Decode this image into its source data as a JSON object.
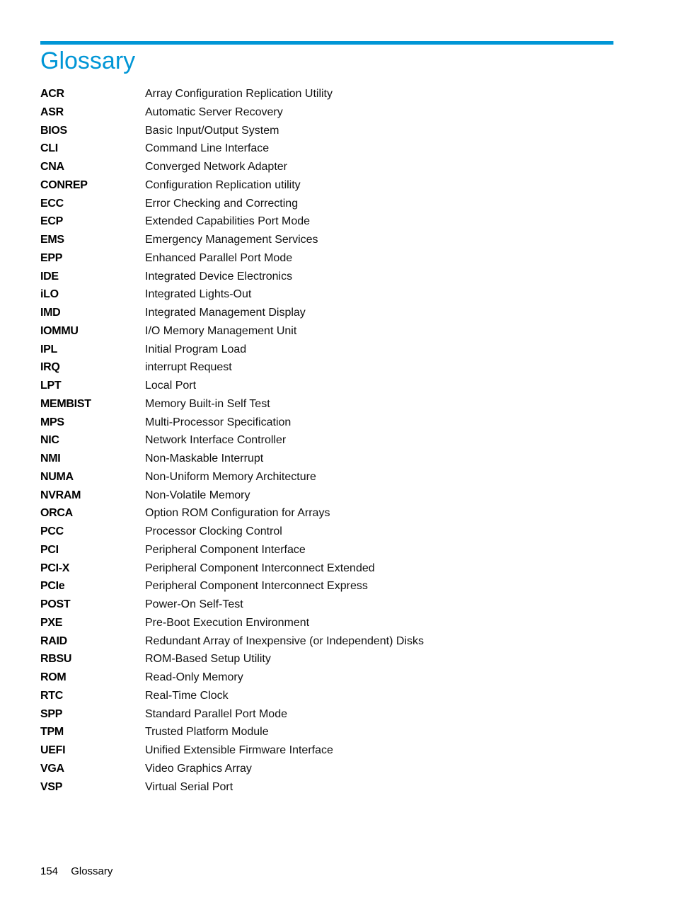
{
  "page": {
    "title": "Glossary",
    "accent_color": "#0096d6"
  },
  "glossary": [
    {
      "term": "ACR",
      "definition": "Array Configuration Replication Utility"
    },
    {
      "term": "ASR",
      "definition": "Automatic Server Recovery"
    },
    {
      "term": "BIOS",
      "definition": "Basic Input/Output System"
    },
    {
      "term": "CLI",
      "definition": "Command Line Interface"
    },
    {
      "term": "CNA",
      "definition": "Converged Network Adapter"
    },
    {
      "term": "CONREP",
      "definition": "Configuration Replication utility"
    },
    {
      "term": "ECC",
      "definition": "Error Checking and Correcting"
    },
    {
      "term": "ECP",
      "definition": "Extended Capabilities Port Mode"
    },
    {
      "term": "EMS",
      "definition": "Emergency Management Services"
    },
    {
      "term": "EPP",
      "definition": "Enhanced Parallel Port Mode"
    },
    {
      "term": "IDE",
      "definition": "Integrated Device Electronics"
    },
    {
      "term": "iLO",
      "definition": "Integrated Lights-Out"
    },
    {
      "term": "IMD",
      "definition": "Integrated Management Display"
    },
    {
      "term": "IOMMU",
      "definition": "I/O Memory Management Unit"
    },
    {
      "term": "IPL",
      "definition": "Initial Program Load"
    },
    {
      "term": "IRQ",
      "definition": "interrupt Request"
    },
    {
      "term": "LPT",
      "definition": "Local Port"
    },
    {
      "term": "MEMBIST",
      "definition": "Memory Built-in Self Test"
    },
    {
      "term": "MPS",
      "definition": "Multi-Processor Specification"
    },
    {
      "term": "NIC",
      "definition": "Network Interface Controller"
    },
    {
      "term": "NMI",
      "definition": "Non-Maskable Interrupt"
    },
    {
      "term": "NUMA",
      "definition": "Non-Uniform Memory Architecture"
    },
    {
      "term": "NVRAM",
      "definition": "Non-Volatile Memory"
    },
    {
      "term": "ORCA",
      "definition": "Option ROM Configuration for Arrays"
    },
    {
      "term": "PCC",
      "definition": "Processor Clocking Control"
    },
    {
      "term": "PCI",
      "definition": "Peripheral Component Interface"
    },
    {
      "term": "PCI-X",
      "definition": "Peripheral Component Interconnect Extended"
    },
    {
      "term": "PCIe",
      "definition": "Peripheral Component Interconnect Express"
    },
    {
      "term": "POST",
      "definition": "Power-On Self-Test"
    },
    {
      "term": "PXE",
      "definition": "Pre-Boot Execution Environment"
    },
    {
      "term": "RAID",
      "definition": "Redundant Array of Inexpensive (or Independent) Disks"
    },
    {
      "term": "RBSU",
      "definition": "ROM-Based Setup Utility"
    },
    {
      "term": "ROM",
      "definition": "Read-Only Memory"
    },
    {
      "term": "RTC",
      "definition": "Real-Time Clock"
    },
    {
      "term": "SPP",
      "definition": "Standard Parallel Port Mode"
    },
    {
      "term": "TPM",
      "definition": "Trusted Platform Module"
    },
    {
      "term": "UEFI",
      "definition": "Unified Extensible Firmware Interface"
    },
    {
      "term": "VGA",
      "definition": "Video Graphics Array"
    },
    {
      "term": "VSP",
      "definition": "Virtual Serial Port"
    }
  ],
  "footer": {
    "page_number": "154",
    "section": "Glossary"
  }
}
